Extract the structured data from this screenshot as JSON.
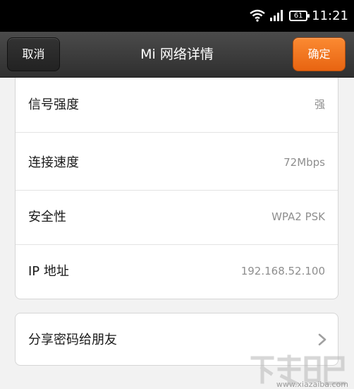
{
  "status_bar": {
    "battery_level": "61",
    "time": "11:21"
  },
  "header": {
    "cancel_label": "取消",
    "title": "Mi 网络详情",
    "confirm_label": "确定",
    "confirm_color": "#f07619"
  },
  "details": [
    {
      "label": "信号强度",
      "value": "强"
    },
    {
      "label": "连接速度",
      "value": "72Mbps"
    },
    {
      "label": "安全性",
      "value": "WPA2 PSK"
    },
    {
      "label": "IP 地址",
      "value": "192.168.52.100"
    }
  ],
  "share": {
    "label": "分享密码给朋友"
  },
  "watermark": {
    "text": "www.xiazaiba.com"
  }
}
